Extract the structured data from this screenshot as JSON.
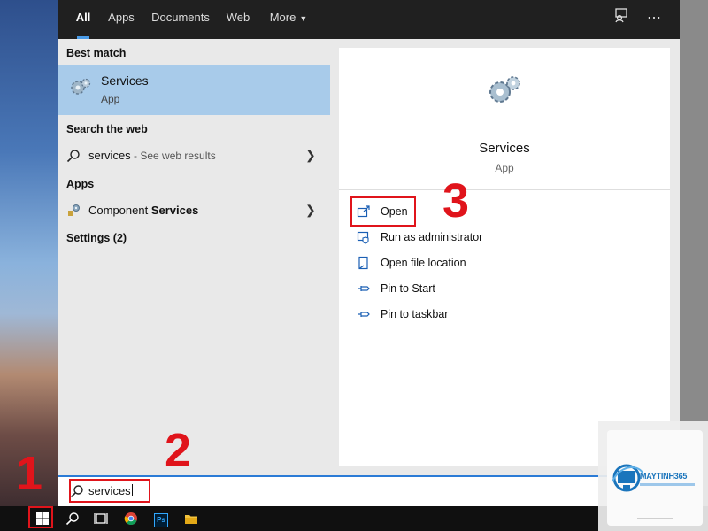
{
  "tabs": [
    {
      "label": "All",
      "active": true
    },
    {
      "label": "Apps",
      "active": false
    },
    {
      "label": "Documents",
      "active": false
    },
    {
      "label": "Web",
      "active": false
    },
    {
      "label": "More",
      "active": false
    }
  ],
  "top_icons": [
    "feedback-icon",
    "more-options-icon"
  ],
  "results": {
    "best_match_heading": "Best match",
    "best_match": {
      "name": "Services",
      "type": "App",
      "icon": "services-gear-icon"
    },
    "web_heading": "Search the web",
    "web_result": {
      "query": "services",
      "suffix": " - See web results",
      "icon": "search-icon"
    },
    "apps_heading": "Apps",
    "app_result": {
      "prefix": "Component ",
      "highlight": "Services",
      "icon": "component-services-icon"
    },
    "settings_heading": "Settings (2)"
  },
  "detail": {
    "title": "Services",
    "type": "App",
    "actions": [
      {
        "label": "Open",
        "icon": "open-icon"
      },
      {
        "label": "Run as administrator",
        "icon": "shield-icon"
      },
      {
        "label": "Open file location",
        "icon": "file-location-icon"
      },
      {
        "label": "Pin to Start",
        "icon": "pin-icon"
      },
      {
        "label": "Pin to taskbar",
        "icon": "pin-icon"
      }
    ]
  },
  "search": {
    "value": "services"
  },
  "taskbar": {
    "items": [
      "windows-start-icon",
      "search-icon",
      "task-view-icon",
      "chrome-icon",
      "photoshop-icon",
      "file-explorer-icon"
    ],
    "photoshop_label": "Ps"
  },
  "annotations": {
    "step1": "1",
    "step2": "2",
    "step3": "3"
  },
  "watermark": {
    "brand": "MAYTINH365"
  },
  "colors": {
    "accent": "#4a9ce8",
    "selection": "#a8cbea",
    "highlight_red": "#e0141b",
    "panel_bg": "#e9e9e9",
    "topbar_bg": "#202020"
  }
}
